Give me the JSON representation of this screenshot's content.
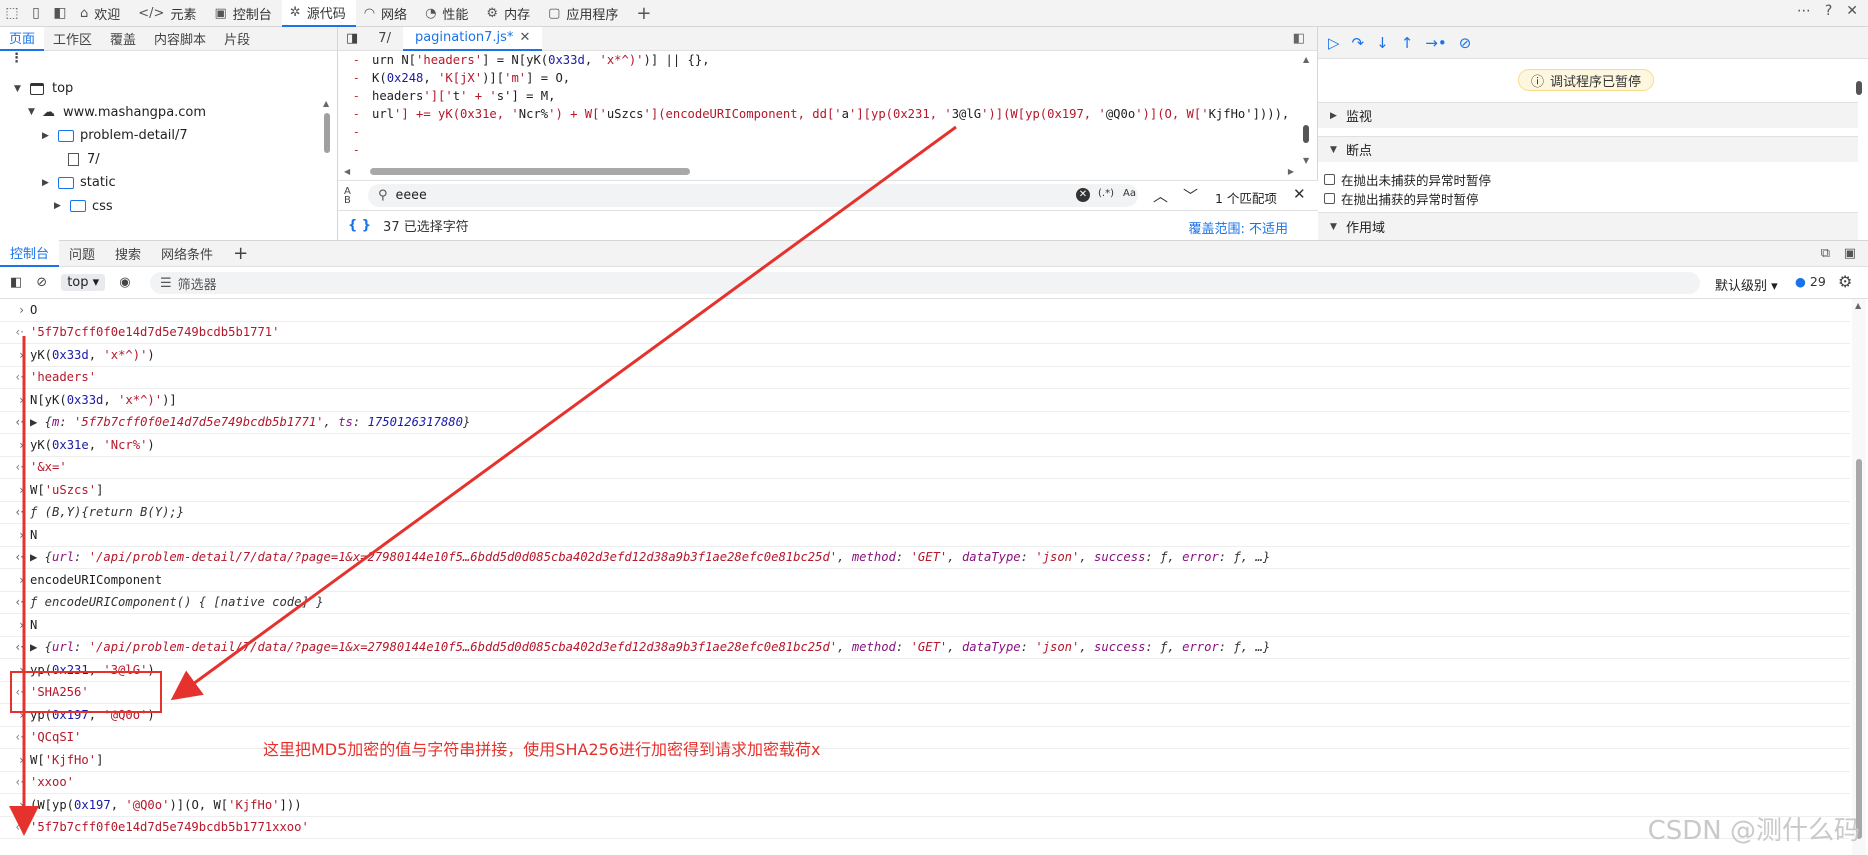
{
  "topbar": {
    "tabs": [
      {
        "icon": "home-icon",
        "label": "欢迎"
      },
      {
        "icon": "code-tags-icon",
        "label": "元素"
      },
      {
        "icon": "terminal-icon",
        "label": "控制台"
      },
      {
        "icon": "bug-icon",
        "label": "源代码"
      },
      {
        "icon": "wifi-icon",
        "label": "网络"
      },
      {
        "icon": "gauge-icon",
        "label": "性能"
      },
      {
        "icon": "memory-icon",
        "label": "内存"
      },
      {
        "icon": "app-window-icon",
        "label": "应用程序"
      }
    ],
    "add": "+",
    "right_icons": [
      "more-icon",
      "help-icon",
      "close-icon"
    ]
  },
  "left": {
    "tabs": [
      "页面",
      "工作区",
      "覆盖",
      "内容脚本",
      "片段"
    ],
    "tree": [
      "top",
      "www.mashangpa.com",
      "problem-detail/7",
      "7/",
      "static",
      "css"
    ]
  },
  "editor": {
    "tabs": [
      "7/",
      "pagination7.js*"
    ],
    "lines": [
      {
        "marker": "-",
        "code": "urn N['headers'] = N[yK(0x33d, 'x*^)')] || {},"
      },
      {
        "marker": "-",
        "code": "K(0x248, 'K[jX')]['m'] = O,"
      },
      {
        "marker": "-",
        "code": "headers']['t' + 's'] = M,"
      },
      {
        "marker": "-",
        "code": "url'] += yK(0x31e, 'Ncr%') + W['uSzcs'](encodeURIComponent, dd['a'][yp(0x231, '3@lG')](W[yp(0x197, '@Q0o')](O, W['KjfHo']))),"
      },
      {
        "marker": "-",
        "code": ""
      },
      {
        "marker": "-",
        "code": ""
      }
    ],
    "search_value": "eeee",
    "search_case_btn": "Aa",
    "search_regex_btn": "(.*)",
    "search_clear_icon": "clear-icon",
    "match_count": "1 个匹配项",
    "status_selected": "37 已选择字符",
    "coverage": "覆盖范围: 不适用"
  },
  "debugger": {
    "paused": "调试程序已暂停",
    "sections": [
      "监视",
      "断点",
      "作用域"
    ],
    "checkbox1": "在抛出未捕获的异常时暂停",
    "checkbox2": "在抛出捕获的异常时暂停"
  },
  "drawer": {
    "tabs": [
      "控制台",
      "问题",
      "搜索",
      "网络条件"
    ],
    "add": "+"
  },
  "console_toolbar": {
    "context": "top",
    "filter_placeholder": "筛选器",
    "level": "默认级别",
    "count": "29"
  },
  "console": [
    {
      "dir": "in",
      "text": "O"
    },
    {
      "dir": "out",
      "text": "'5f7b7cff0f0e14d7d5e749bcdb5b1771'"
    },
    {
      "dir": "in",
      "text": "yK(0x33d, 'x*^)')"
    },
    {
      "dir": "out",
      "text": "'headers'"
    },
    {
      "dir": "in",
      "text": "N[yK(0x33d, 'x*^)')]"
    },
    {
      "dir": "obj",
      "text": "▶ {m: '5f7b7cff0f0e14d7d5e749bcdb5b1771', ts: 1750126317880}"
    },
    {
      "dir": "in",
      "text": "yK(0x31e, 'Ncr%')"
    },
    {
      "dir": "out",
      "text": "'&x='"
    },
    {
      "dir": "in",
      "text": "W['uSzcs']"
    },
    {
      "dir": "fn",
      "text": "ƒ (B,Y){return B(Y);}"
    },
    {
      "dir": "in",
      "text": "N"
    },
    {
      "dir": "obj",
      "text": "▶ {url: '/api/problem-detail/7/data/?page=1&x=27980144e10f5…6bdd5d0d085cba402d3efd12d38a9b3f1ae28efc0e81bc25d', method: 'GET', dataType: 'json', success: ƒ, error: ƒ, …}"
    },
    {
      "dir": "in",
      "text": "encodeURIComponent"
    },
    {
      "dir": "fn",
      "text": "ƒ encodeURIComponent() { [native code] }"
    },
    {
      "dir": "in",
      "text": "N"
    },
    {
      "dir": "obj",
      "text": "▶ {url: '/api/problem-detail/7/data/?page=1&x=27980144e10f5…6bdd5d0d085cba402d3efd12d38a9b3f1ae28efc0e81bc25d', method: 'GET', dataType: 'json', success: ƒ, error: ƒ, …}"
    },
    {
      "dir": "in",
      "text": "yp(0x231, '3@lG')"
    },
    {
      "dir": "out",
      "text": "'SHA256'"
    },
    {
      "dir": "in",
      "text": "yp(0x197, '@Q0o')"
    },
    {
      "dir": "out",
      "text": "'QCqSI'"
    },
    {
      "dir": "in",
      "text": "W['KjfHo']"
    },
    {
      "dir": "out",
      "text": "'xxoo'"
    },
    {
      "dir": "in",
      "text": "(W[yp(0x197, '@Q0o')](O, W['KjfHo']))"
    },
    {
      "dir": "out",
      "text": "'5f7b7cff0f0e14d7d5e749bcdb5b1771xxoo'"
    }
  ],
  "annotation": "这里把MD5加密的值与字符串拼接，使用SHA256进行加密得到请求加密载荷x",
  "watermark": "CSDN @测什么码",
  "colors": {
    "accent": "#1a73e8",
    "annotation": "#e5322d",
    "string": "#b5172b",
    "number": "#1a1aa6"
  }
}
